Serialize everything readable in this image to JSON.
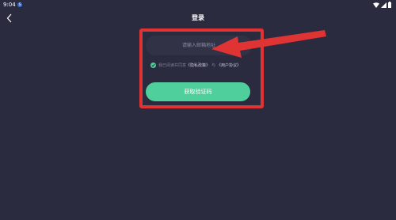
{
  "status_bar": {
    "time": "9:04",
    "badge": "S"
  },
  "header": {
    "title": "登录",
    "back_icon": "chevron-left-icon"
  },
  "form": {
    "email_placeholder": "请输入邮箱地址",
    "agreement": {
      "prefix": "我已阅读并同意",
      "privacy_link": "《隐私政策》",
      "conjunction": "与",
      "terms_link": "《用户协议》",
      "checked": true
    },
    "submit_label": "获取验证码"
  },
  "annotation": {
    "highlight_color": "#e03434"
  },
  "colors": {
    "background": "#2b2b3f",
    "input_background": "#323247",
    "accent": "#4fcf9b"
  }
}
